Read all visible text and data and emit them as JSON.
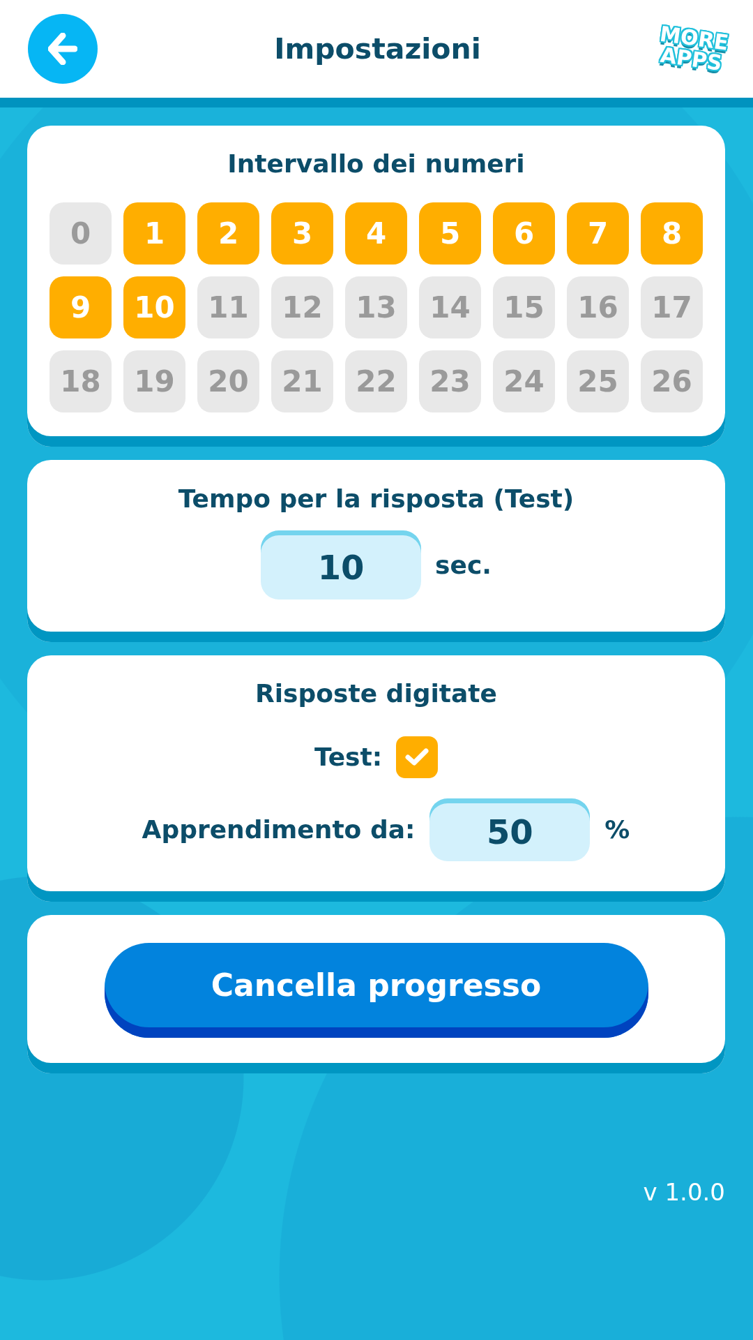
{
  "header": {
    "title": "Impostazioni",
    "more_apps": [
      "MORE",
      "APPS"
    ]
  },
  "number_range": {
    "title": "Intervallo dei numeri",
    "numbers": [
      {
        "label": "0",
        "selected": false
      },
      {
        "label": "1",
        "selected": true
      },
      {
        "label": "2",
        "selected": true
      },
      {
        "label": "3",
        "selected": true
      },
      {
        "label": "4",
        "selected": true
      },
      {
        "label": "5",
        "selected": true
      },
      {
        "label": "6",
        "selected": true
      },
      {
        "label": "7",
        "selected": true
      },
      {
        "label": "8",
        "selected": true
      },
      {
        "label": "9",
        "selected": true
      },
      {
        "label": "10",
        "selected": true
      },
      {
        "label": "11",
        "selected": false
      },
      {
        "label": "12",
        "selected": false
      },
      {
        "label": "13",
        "selected": false
      },
      {
        "label": "14",
        "selected": false
      },
      {
        "label": "15",
        "selected": false
      },
      {
        "label": "16",
        "selected": false
      },
      {
        "label": "17",
        "selected": false
      },
      {
        "label": "18",
        "selected": false
      },
      {
        "label": "19",
        "selected": false
      },
      {
        "label": "20",
        "selected": false
      },
      {
        "label": "21",
        "selected": false
      },
      {
        "label": "22",
        "selected": false
      },
      {
        "label": "23",
        "selected": false
      },
      {
        "label": "24",
        "selected": false
      },
      {
        "label": "25",
        "selected": false
      },
      {
        "label": "26",
        "selected": false
      }
    ]
  },
  "answer_time": {
    "title": "Tempo per la risposta (Test)",
    "value": "10",
    "unit": "sec."
  },
  "typed_answers": {
    "title": "Risposte digitate",
    "test": {
      "label": "Test:",
      "checked": true
    },
    "learning": {
      "label": "Apprendimento da:",
      "value": "50",
      "unit": "%"
    }
  },
  "reset_button": {
    "label": "Cancella progresso"
  },
  "version": "v 1.0.0"
}
